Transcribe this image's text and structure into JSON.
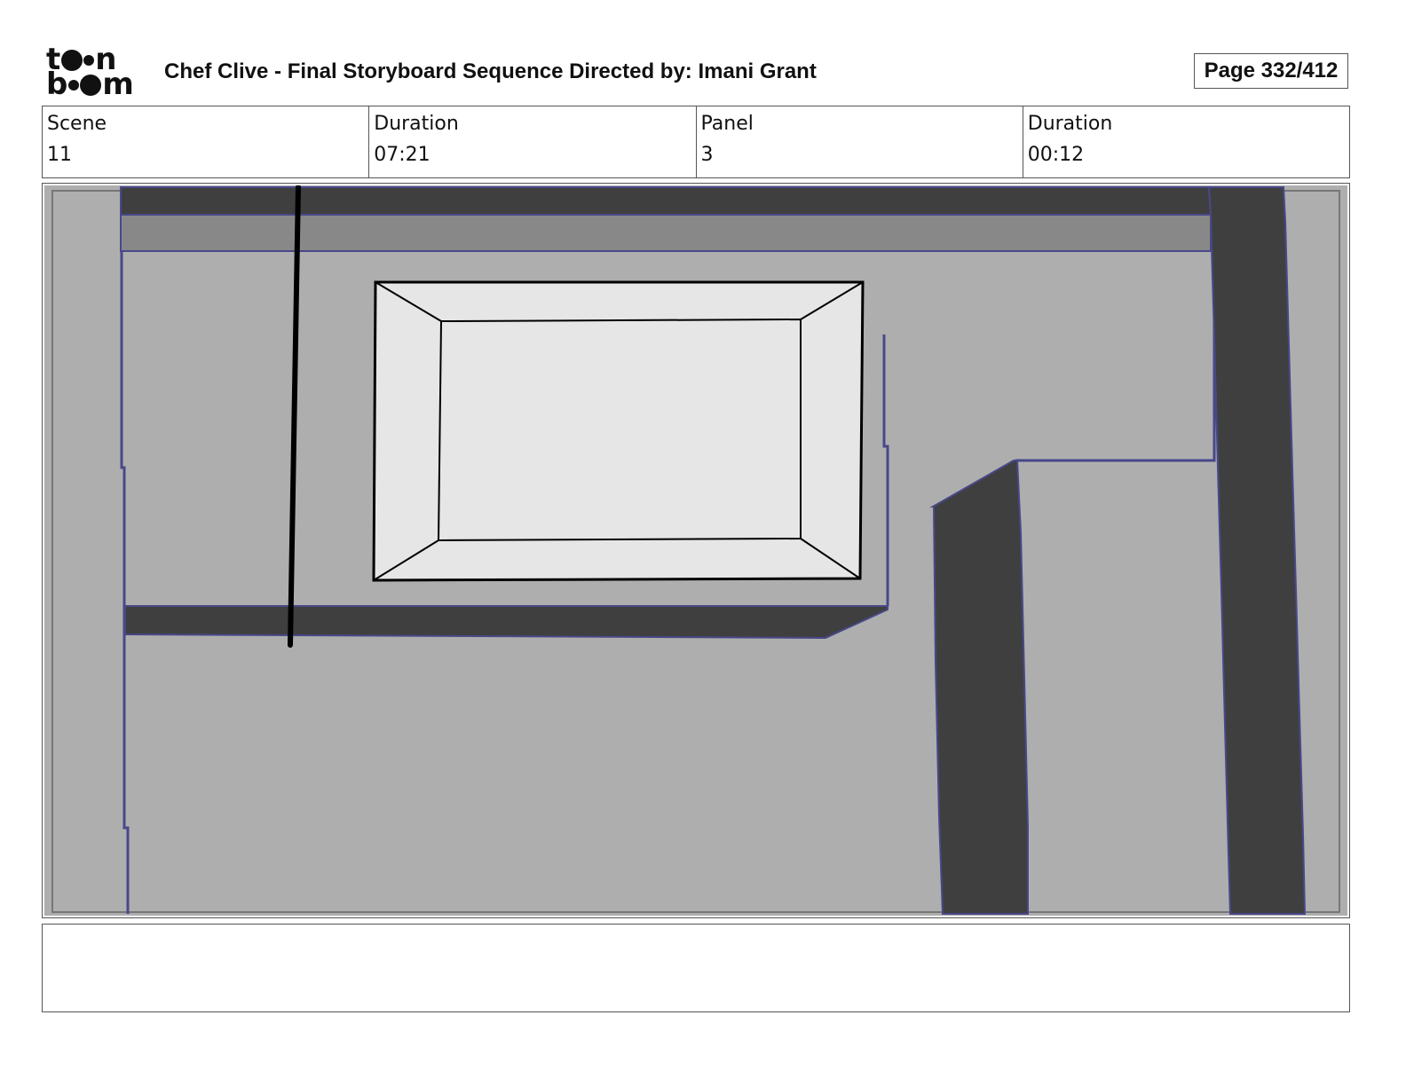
{
  "header": {
    "logo": {
      "top": "toon",
      "bottom": "boom"
    },
    "title": "Chef Clive - Final Storyboard Sequence  Directed by: Imani Grant",
    "page": "Page 332/412"
  },
  "info_fields": [
    {
      "label": "Scene",
      "value": "11"
    },
    {
      "label": "Duration",
      "value": "07:21"
    },
    {
      "label": "Panel",
      "value": "3"
    },
    {
      "label": "Duration",
      "value": "00:12"
    }
  ],
  "notes": {
    "text": ""
  },
  "colors": {
    "panel_bg": "#aeaeae",
    "shelf_light": "#888888",
    "dark_fill": "#3f3f3f",
    "outline_blue": "#48488a",
    "window_fill": "#e6e6e6",
    "line_black": "#000000"
  }
}
